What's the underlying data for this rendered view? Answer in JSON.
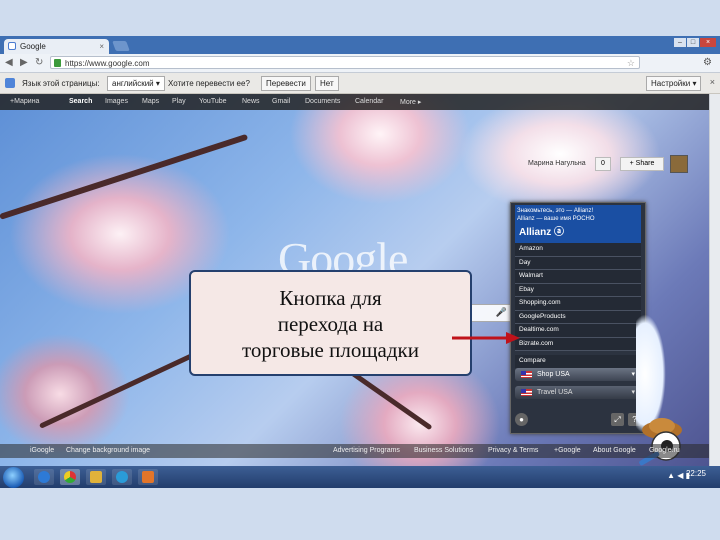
{
  "browser": {
    "tab_title": "Google",
    "tab_close": "×",
    "url": "https://www.google.com",
    "window_buttons": [
      "–",
      "□",
      "×"
    ]
  },
  "translate_bar": {
    "text_before": "Язык этой страницы:",
    "language": "английский ▾",
    "text_after": "Хотите перевести ее?",
    "translate_button": "Перевести",
    "no_button": "Нет",
    "settings_button": "Настройки ▾",
    "close": "×"
  },
  "google_nav": {
    "items": [
      "+Марина",
      "Search",
      "Images",
      "Maps",
      "Play",
      "YouTube",
      "News",
      "Gmail",
      "Documents",
      "Calendar",
      "More ▸"
    ],
    "active_index": 1
  },
  "account": {
    "name": "Марина Нагульна",
    "count": "0",
    "share": "+ Share"
  },
  "logo": "Google",
  "widget": {
    "ad_lines": [
      "Знакомьтесь, это — Allianz!",
      "Allianz — ваше имя РОСНО"
    ],
    "ad_logo": "Allianz ⓐ",
    "stores": [
      "Amazon",
      "Day",
      "Walmart",
      "Ebay",
      "Shopping.com",
      "GoogleProducts",
      "Dealtime.com",
      "Bizrate.com",
      "Compare"
    ],
    "shop_select": "Shop USA",
    "travel_select": "Travel USA",
    "caret": "▾"
  },
  "callout": {
    "line1": "Кнопка для",
    "line2": "перехода на",
    "line3": "торговые площадки"
  },
  "footer": {
    "left": [
      "iGoogle",
      "Change background image"
    ],
    "right": [
      "Advertising Programs",
      "Business Solutions",
      "Privacy & Terms",
      "+Google",
      "About Google",
      "Google.ru"
    ]
  },
  "taskbar": {
    "time": "22:25",
    "tray_icons": "▲ ◀ ▮"
  },
  "colors": {
    "callout_border": "#25406e",
    "callout_bg": "#f5e8e6",
    "arrow": "#c0121a",
    "slide_bg": "#cfdcee"
  }
}
